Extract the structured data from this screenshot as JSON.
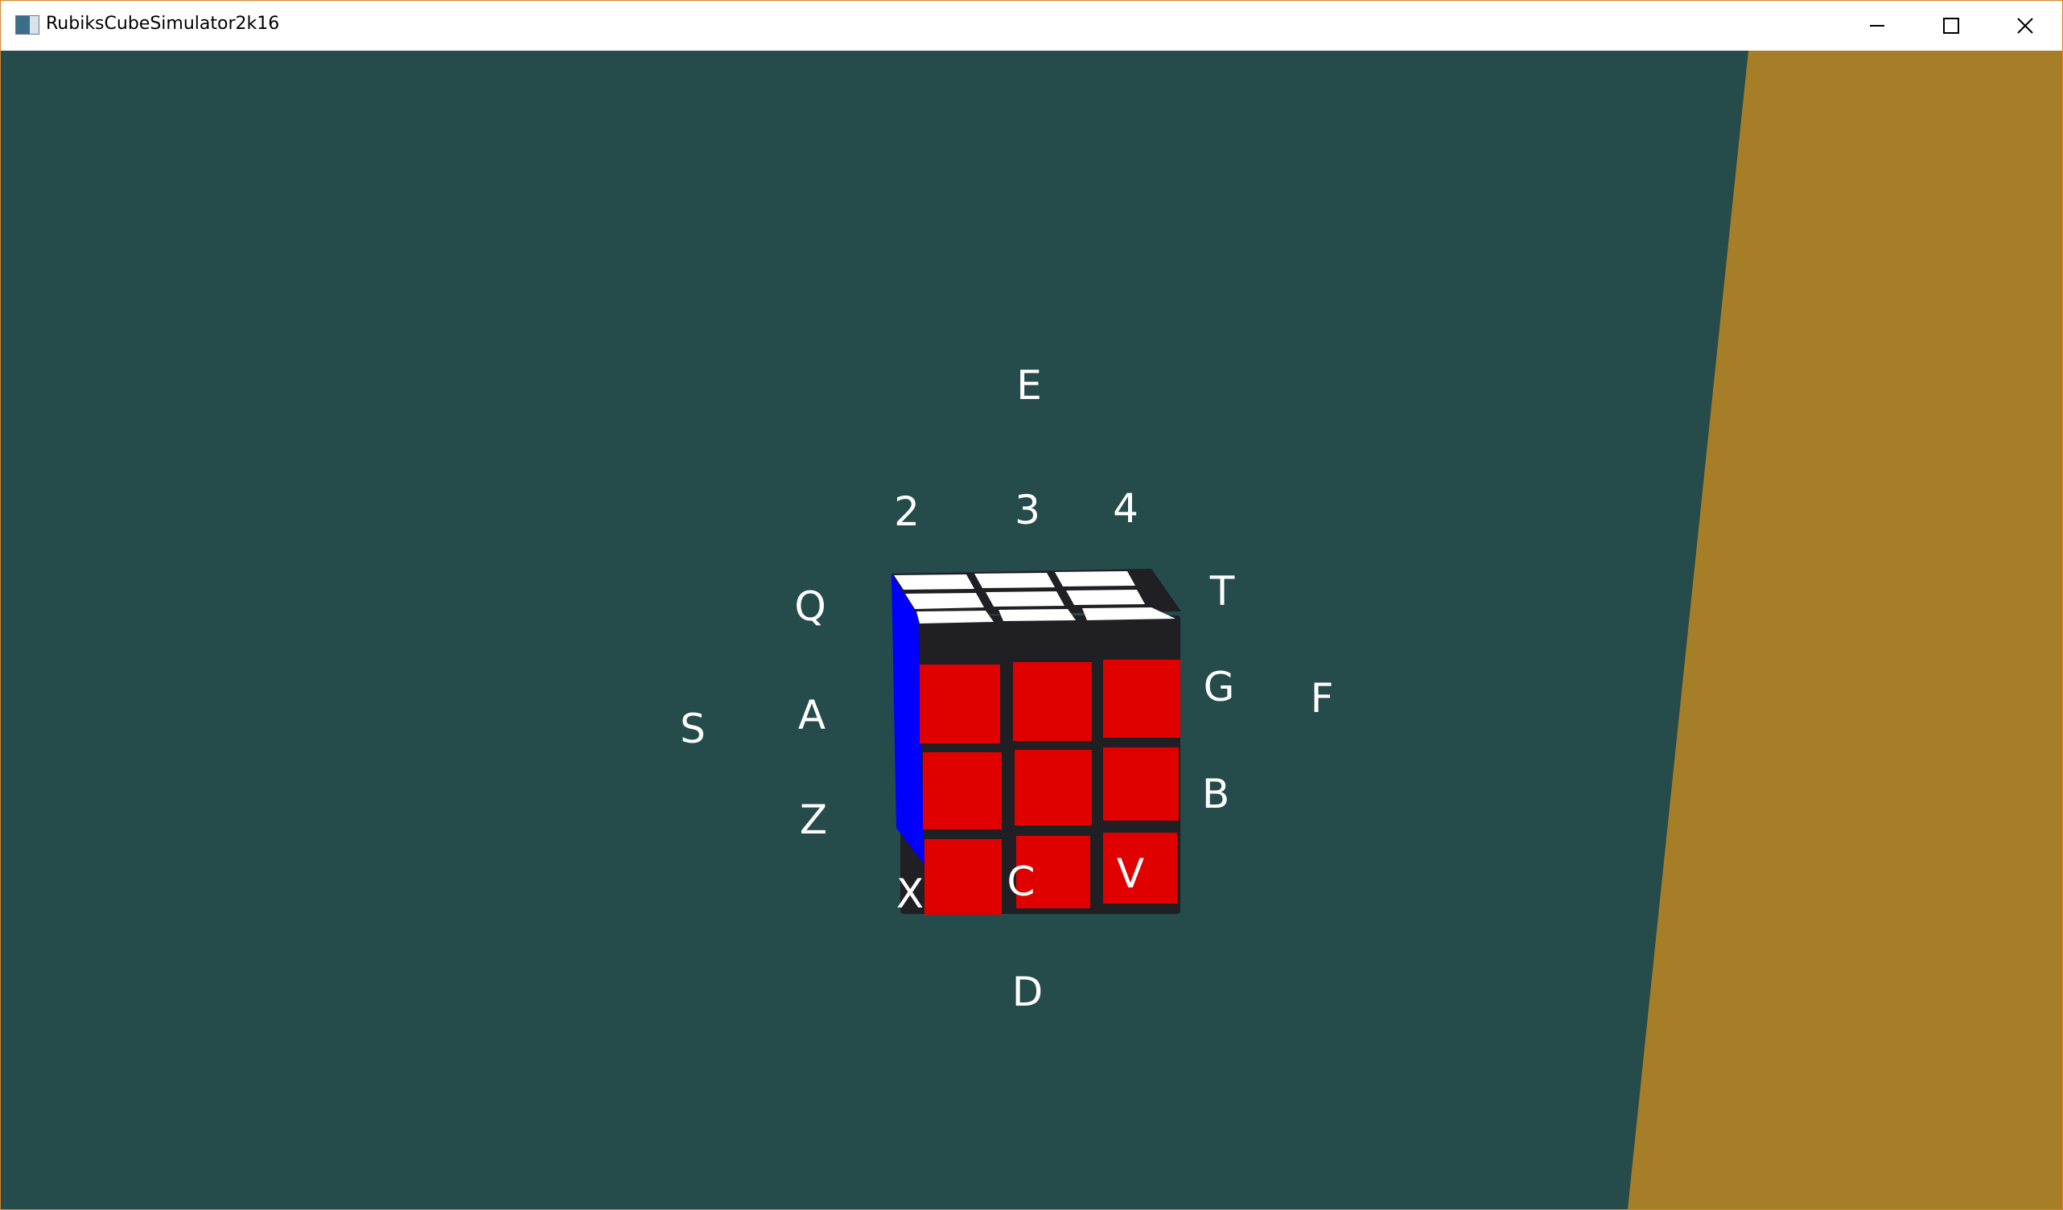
{
  "window": {
    "title": "RubiksCubeSimulator2k16",
    "controls": {
      "minimize_icon": "minimize-icon",
      "maximize_icon": "maximize-icon",
      "close_icon": "close-icon"
    }
  },
  "scene": {
    "background_color": "#254b4b",
    "floor_color": "#a57e27",
    "cube": {
      "front_face_color": "#e00000",
      "top_face_color": "#ffffff",
      "left_face_color": "#0000ff",
      "gap_color": "#1f1f24"
    },
    "labels": {
      "E": "E",
      "two": "2",
      "three": "3",
      "four": "4",
      "Q": "Q",
      "T": "T",
      "G": "G",
      "F": "F",
      "S": "S",
      "A": "A",
      "Z": "Z",
      "B": "B",
      "X": "X",
      "C": "C",
      "V": "V",
      "D": "D"
    }
  }
}
